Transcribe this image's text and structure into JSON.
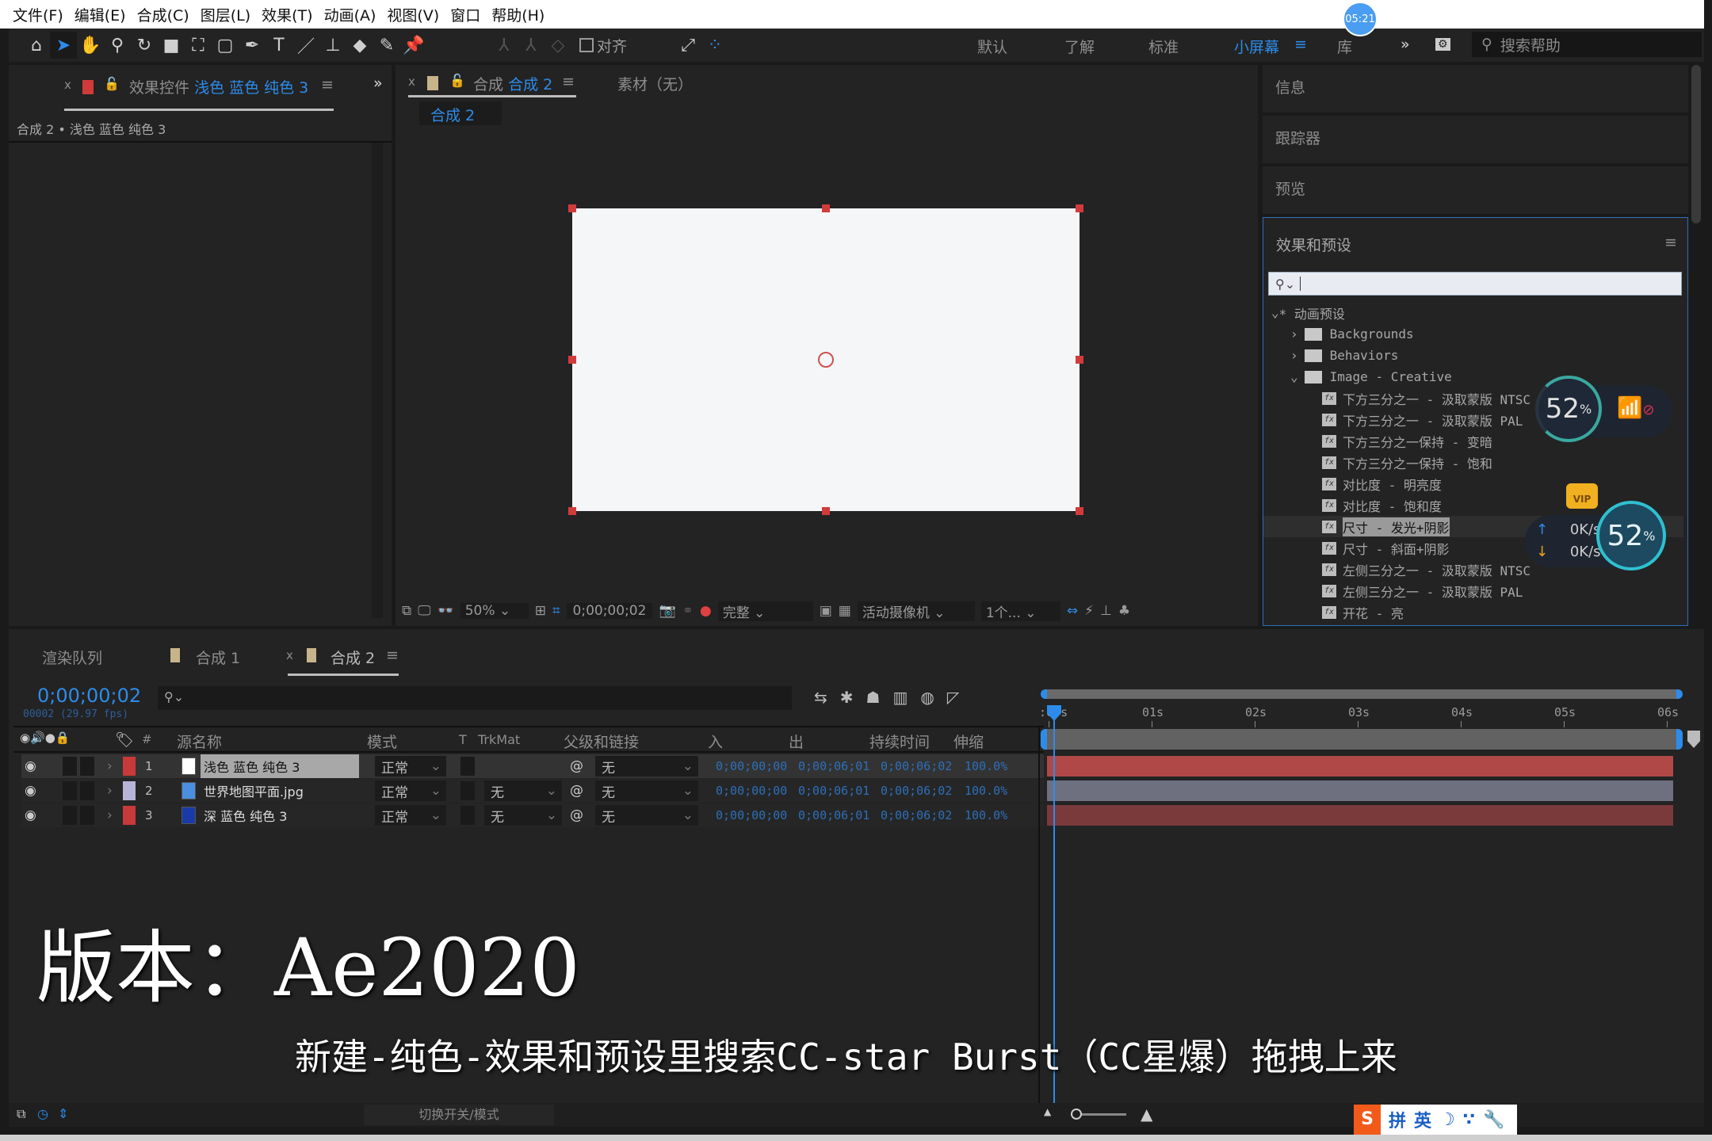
{
  "menu": [
    "文件(F)",
    "编辑(E)",
    "合成(C)",
    "图层(L)",
    "效果(T)",
    "动画(A)",
    "视图(V)",
    "窗口",
    "帮助(H)"
  ],
  "clock": "05:21",
  "toolbar": {
    "align_label": "对齐",
    "workspaces": [
      "默认",
      "了解",
      "标准",
      "小屏幕",
      "库"
    ],
    "active_workspace": "小屏幕",
    "search_placeholder": "搜索帮助"
  },
  "effect_controls": {
    "tab_prefix": "效果控件",
    "tab_layer": "浅色 蓝色 纯色 3",
    "breadcrumb": "合成 2 • 浅色 蓝色 纯色 3"
  },
  "composition": {
    "tab_prefix": "合成",
    "tab_name": "合成 2",
    "footage_tab": "素材（无）",
    "subtab": "合成 2",
    "canvas_color": "#f5f6f8",
    "viewer_bar": {
      "zoom": "50%",
      "timecode": "0;00;00;02",
      "resolution": "完整",
      "camera": "活动摄像机",
      "views": "1个..."
    }
  },
  "right_panels": {
    "info": "信息",
    "tracker": "跟踪器",
    "preview": "预览",
    "effects_presets": {
      "title": "效果和预设",
      "search_value": "",
      "root": "* 动画预设",
      "folders": [
        "Backgrounds",
        "Behaviors",
        "Image - Creative"
      ],
      "items": [
        "下方三分之一 - 汲取蒙版 NTSC",
        "下方三分之一 - 汲取蒙版 PAL",
        "下方三分之一保持 - 变暗",
        "下方三分之一保持 - 饱和",
        "对比度 - 明亮度",
        "对比度 - 饱和度",
        "尺寸 - 发光+阴影",
        "尺寸 - 斜面+阴影",
        "左侧三分之一 - 汲取蒙版 NTSC",
        "左侧三分之一 - 汲取蒙版 PAL",
        "开花 - 亮"
      ],
      "selected_item": "尺寸 - 发光+阴影"
    }
  },
  "overlay_widgets": {
    "cpu_percent_1": "52",
    "cpu_percent_2": "52",
    "percent_sign": "%",
    "upload": "0K/s",
    "download": "0K/s",
    "vip": "VIP"
  },
  "timeline": {
    "tabs": [
      "渲染队列",
      "合成 1",
      "合成 2"
    ],
    "active_tab": "合成 2",
    "timecode": "0;00;00;02",
    "frame_info": "00002 (29.97 fps)",
    "columns": {
      "num": "#",
      "source": "源名称",
      "mode": "模式",
      "t": "T",
      "trkmat": "TrkMat",
      "parent": "父级和链接",
      "in": "入",
      "out": "出",
      "duration": "持续时间",
      "stretch": "伸缩"
    },
    "layers": [
      {
        "num": "1",
        "name": "浅色 蓝色 纯色 3",
        "label_color": "#c83a3a",
        "swatch": "#ffffff",
        "mode": "正常",
        "trkmat": "",
        "parent": "无",
        "in": "0;00;00;00",
        "out": "0;00;06;01",
        "duration": "0;00;06;02",
        "stretch": "100.0%",
        "bar_color": "#b04848",
        "selected": true
      },
      {
        "num": "2",
        "name": "世界地图平面.jpg",
        "label_color": "#b8b4d8",
        "swatch": "#4a8fe0",
        "mode": "正常",
        "trkmat": "无",
        "parent": "无",
        "in": "0;00;00;00",
        "out": "0;00;06;01",
        "duration": "0;00;06;02",
        "stretch": "100.0%",
        "bar_color": "#6e7080",
        "selected": false
      },
      {
        "num": "3",
        "name": "深 蓝色 纯色 3",
        "label_color": "#c83a3a",
        "swatch": "#1a3aa8",
        "mode": "正常",
        "trkmat": "无",
        "parent": "无",
        "in": "0;00;00;00",
        "out": "0;00;06;01",
        "duration": "0;00;06;02",
        "stretch": "100.0%",
        "bar_color": "#7a3a3c",
        "selected": false
      }
    ],
    "ruler": [
      ":00s",
      "01s",
      "02s",
      "03s",
      "04s",
      "05s",
      "06s"
    ],
    "toggle_label": "切换开关/模式"
  },
  "caption": {
    "title": "版本：Ae2020",
    "subtitle": "新建-纯色-效果和预设里搜索CC-star Burst（CC星爆）拖拽上来"
  },
  "ime": [
    "拼",
    "英"
  ]
}
